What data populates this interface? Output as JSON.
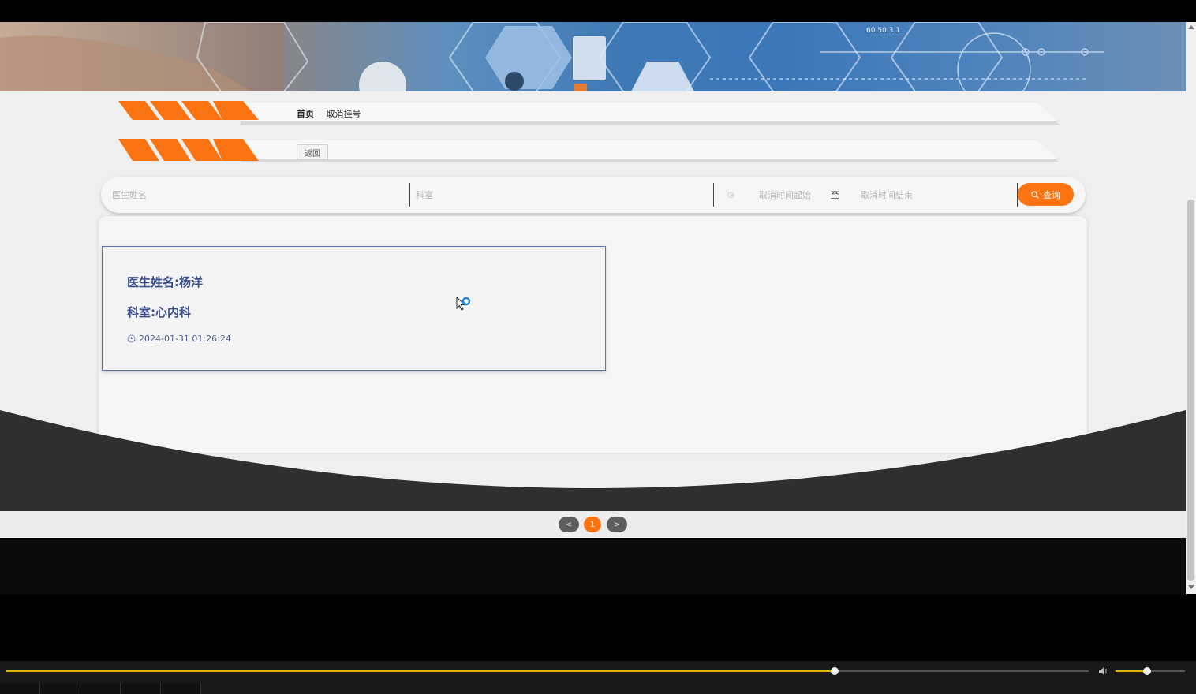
{
  "breadcrumb": {
    "home": "首页",
    "separator": "·",
    "current": "取消挂号"
  },
  "back_label": "返回",
  "search": {
    "doctor_placeholder": "医生姓名",
    "dept_placeholder": "科室",
    "start_placeholder": "取消时间起始",
    "range_separator": "至",
    "end_placeholder": "取消时间结束",
    "query_label": "查询"
  },
  "records": [
    {
      "doctor": "医生姓名:杨洋",
      "dept": "科室:心内科",
      "time": "2024-01-31 01:26:24"
    }
  ],
  "pagination": {
    "prev": "<",
    "current": "1",
    "next": ">"
  },
  "player": {
    "progress": 0.765,
    "volume": 0.45
  },
  "colors": {
    "accent": "#fb7411",
    "card_text": "#3b4f8f",
    "card_border": "#5a74b8"
  },
  "icons": {
    "clock": "clock-icon",
    "search": "search-icon",
    "speaker": "speaker-icon"
  }
}
